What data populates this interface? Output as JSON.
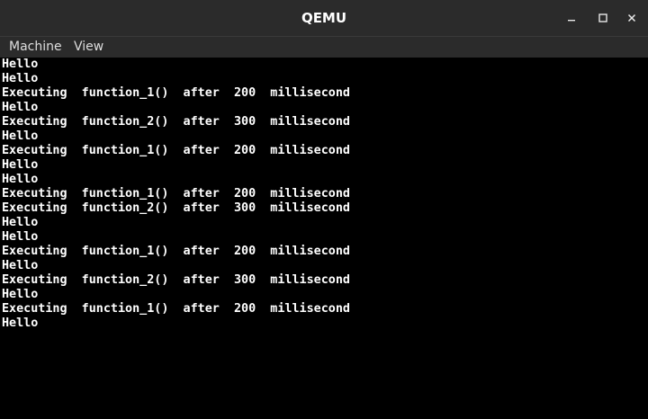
{
  "window": {
    "title": "QEMU"
  },
  "menu": {
    "items": [
      "Machine",
      "View"
    ]
  },
  "console": {
    "lines": [
      "Hello",
      "Hello",
      "Executing  function_1()  after  200  millisecond",
      "Hello",
      "Executing  function_2()  after  300  millisecond",
      "Hello",
      "Executing  function_1()  after  200  millisecond",
      "Hello",
      "Hello",
      "Executing  function_1()  after  200  millisecond",
      "Executing  function_2()  after  300  millisecond",
      "Hello",
      "Hello",
      "Executing  function_1()  after  200  millisecond",
      "Hello",
      "Executing  function_2()  after  300  millisecond",
      "Hello",
      "Executing  function_1()  after  200  millisecond",
      "Hello"
    ]
  },
  "colors": {
    "titlebar": "#2b2b2b",
    "console_bg": "#000000",
    "console_fg": "#ffffff"
  },
  "icons": {
    "minimize": "minimize-icon",
    "maximize": "maximize-icon",
    "close": "close-icon"
  }
}
